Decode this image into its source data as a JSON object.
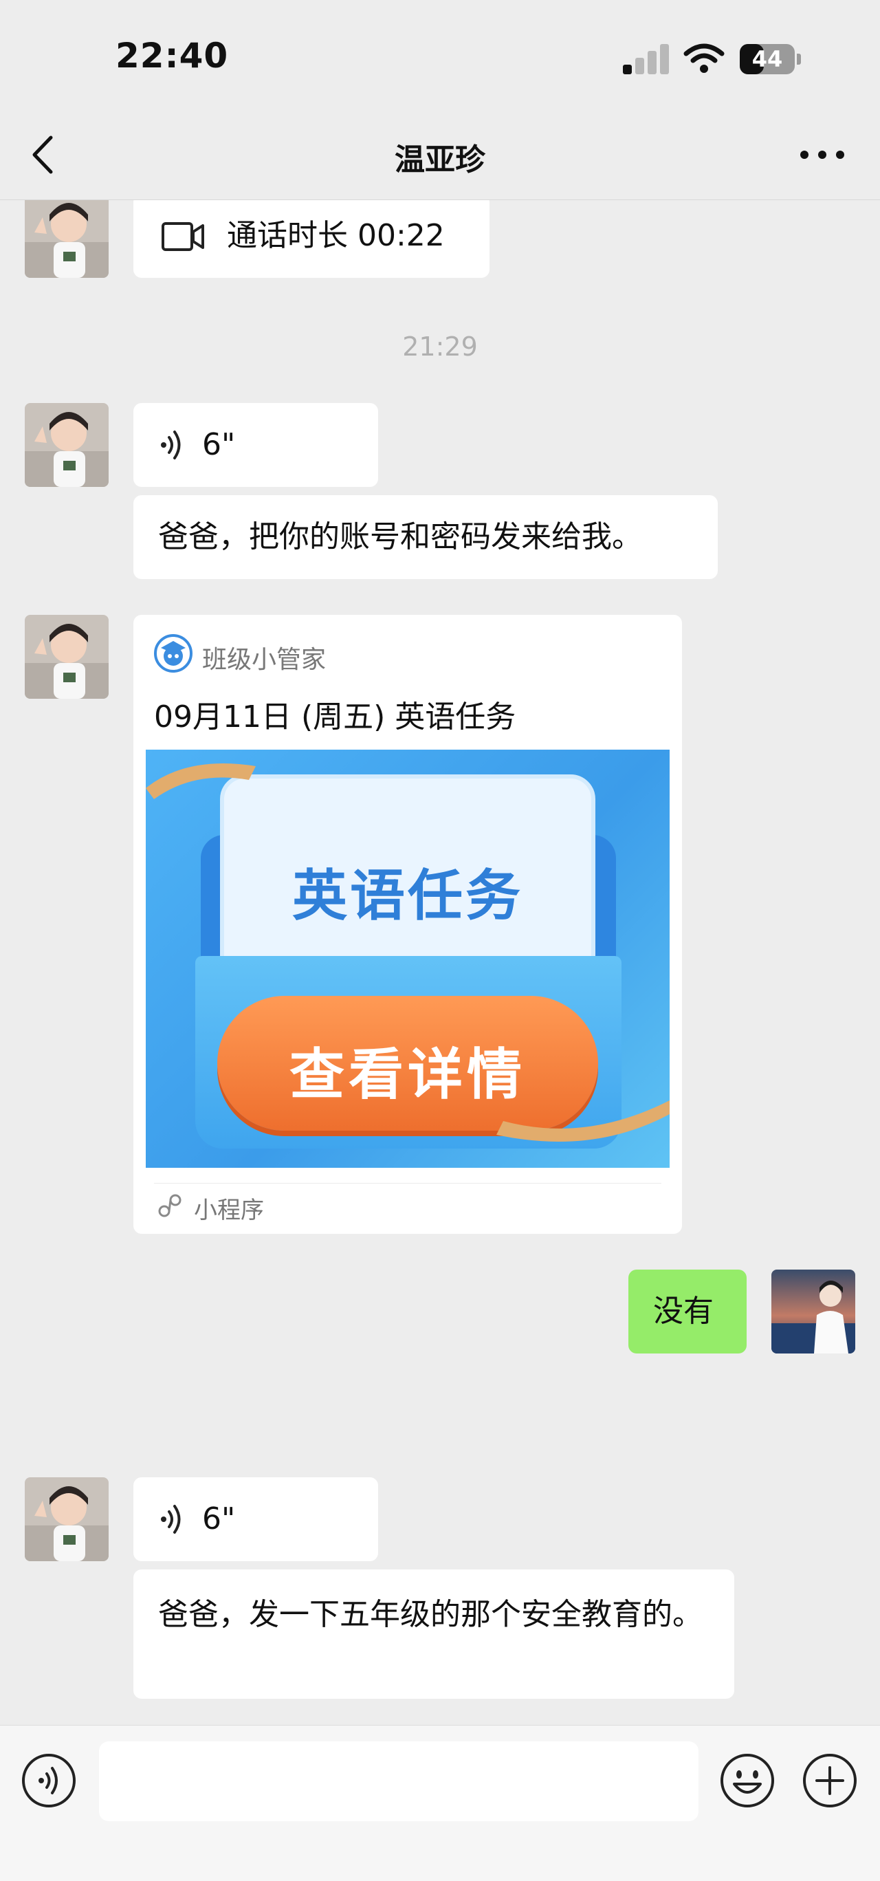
{
  "status_bar": {
    "time": "22:40",
    "battery": "44",
    "battery_level": 0.44
  },
  "nav": {
    "title": "温亚珍"
  },
  "messages": {
    "call": {
      "text": "通话时长 00:22"
    },
    "timestamp": "21:29",
    "voice1": {
      "duration": "6\""
    },
    "text1": "爸爸，把你的账号和密码发来给我。",
    "card": {
      "app_name": "班级小管家",
      "title": "09月11日 (周五) 英语任务",
      "banner_heading": "英语任务",
      "banner_button": "查看详情",
      "footer": "小程序"
    },
    "my_reply": "没有",
    "voice2": {
      "duration": "6\""
    },
    "text2": "爸爸，发一下五年级的那个安全教育的。"
  },
  "input": {
    "value": ""
  },
  "colors": {
    "accent_green": "#95ec69",
    "bubble_white": "#ffffff",
    "background": "#ededed",
    "card_blue": "#3fa5ee",
    "button_orange": "#f07a3c"
  }
}
